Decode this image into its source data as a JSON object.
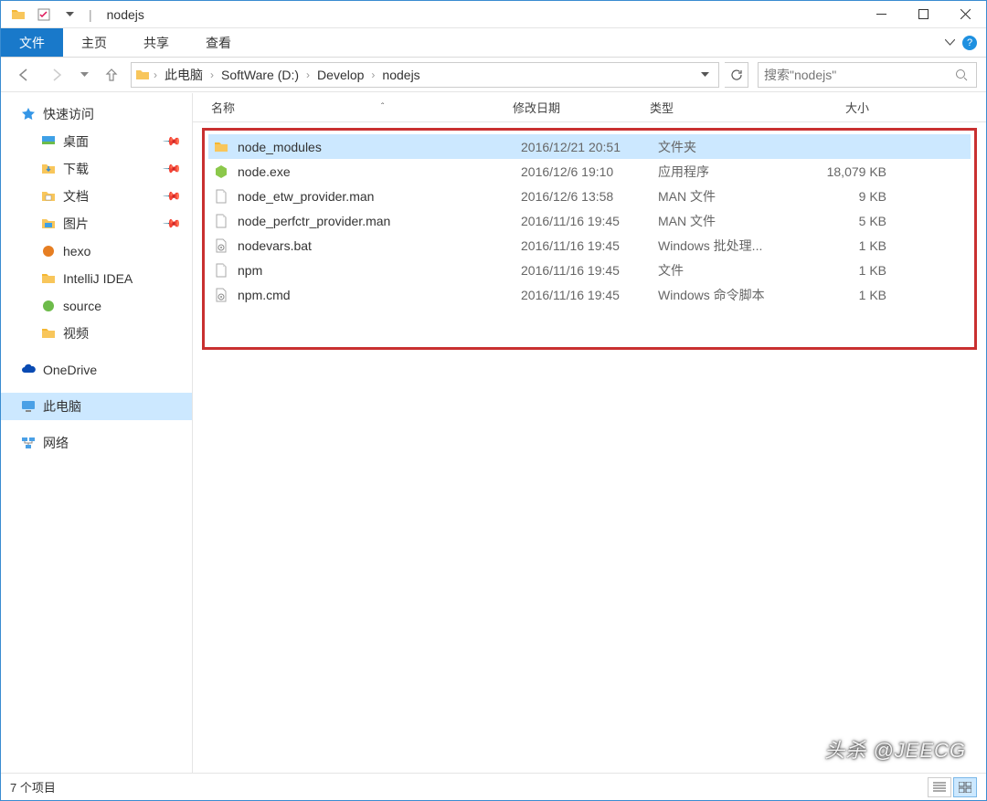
{
  "window": {
    "title": "nodejs"
  },
  "ribbon": {
    "file": "文件",
    "tabs": [
      "主页",
      "共享",
      "查看"
    ]
  },
  "breadcrumb": [
    "此电脑",
    "SoftWare (D:)",
    "Develop",
    "nodejs"
  ],
  "search": {
    "placeholder": "搜索\"nodejs\""
  },
  "sidebar": {
    "quick_access": "快速访问",
    "quick_items": [
      {
        "label": "桌面",
        "icon": "desktop",
        "pinned": true
      },
      {
        "label": "下载",
        "icon": "download",
        "pinned": true
      },
      {
        "label": "文档",
        "icon": "document",
        "pinned": true
      },
      {
        "label": "图片",
        "icon": "picture",
        "pinned": true
      },
      {
        "label": "hexo",
        "icon": "hexo",
        "pinned": false
      },
      {
        "label": "IntelliJ IDEA",
        "icon": "folder",
        "pinned": false
      },
      {
        "label": "source",
        "icon": "source",
        "pinned": false
      },
      {
        "label": "视频",
        "icon": "folder",
        "pinned": false
      }
    ],
    "onedrive": "OneDrive",
    "thispc": "此电脑",
    "network": "网络"
  },
  "columns": {
    "name": "名称",
    "date": "修改日期",
    "type": "类型",
    "size": "大小"
  },
  "files": [
    {
      "name": "node_modules",
      "date": "2016/12/21 20:51",
      "type": "文件夹",
      "size": "",
      "icon": "folder",
      "selected": true
    },
    {
      "name": "node.exe",
      "date": "2016/12/6 19:10",
      "type": "应用程序",
      "size": "18,079 KB",
      "icon": "node"
    },
    {
      "name": "node_etw_provider.man",
      "date": "2016/12/6 13:58",
      "type": "MAN 文件",
      "size": "9 KB",
      "icon": "file"
    },
    {
      "name": "node_perfctr_provider.man",
      "date": "2016/11/16 19:45",
      "type": "MAN 文件",
      "size": "5 KB",
      "icon": "file"
    },
    {
      "name": "nodevars.bat",
      "date": "2016/11/16 19:45",
      "type": "Windows 批处理...",
      "size": "1 KB",
      "icon": "bat"
    },
    {
      "name": "npm",
      "date": "2016/11/16 19:45",
      "type": "文件",
      "size": "1 KB",
      "icon": "file"
    },
    {
      "name": "npm.cmd",
      "date": "2016/11/16 19:45",
      "type": "Windows 命令脚本",
      "size": "1 KB",
      "icon": "bat"
    }
  ],
  "status": {
    "count": "7 个项目"
  },
  "watermark": "头杀 @JEECG"
}
